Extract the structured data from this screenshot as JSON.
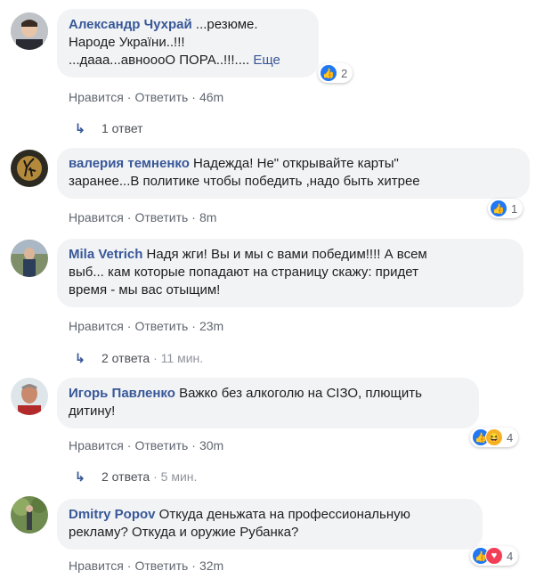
{
  "comments": [
    {
      "author": "Александр Чухрай",
      "text_lines": [
        " ...резюме.",
        "Народе України..!!!",
        "...дааа...авноооО ПОРА..!!!.... "
      ],
      "more": "Еще",
      "like": "Нравится",
      "reply": "Ответить",
      "time": "46m",
      "reactions": {
        "icons": [
          "like-icon"
        ],
        "count": "2"
      },
      "replies": {
        "label": "1 ответ",
        "ago": ""
      }
    },
    {
      "author": "валерия темненко",
      "text_lines": [
        " Надежда! Не\" открывайте карты\"",
        "заранее...В политике чтобы победить ,надо быть хитрее"
      ],
      "like": "Нравится",
      "reply": "Ответить",
      "time": "8m",
      "reactions": {
        "icons": [
          "like-icon"
        ],
        "count": "1"
      }
    },
    {
      "author": "Mila Vetrich",
      "text_lines": [
        " Надя жги! Вы и мы с вами победим!!!! А всем",
        "выб... кам которые попадают на страницу скажу: придет",
        "время - мы вас отыщим!"
      ],
      "like": "Нравится",
      "reply": "Ответить",
      "time": "23m",
      "replies": {
        "label": "2 ответа",
        "ago": " · 11 мин."
      }
    },
    {
      "author": "Игорь Павленко",
      "text_lines": [
        " Важко без алкоголю на СІЗО, плющить",
        "дитину!"
      ],
      "like": "Нравится",
      "reply": "Ответить",
      "time": "30m",
      "reactions": {
        "icons": [
          "like-icon",
          "haha-icon"
        ],
        "count": "4"
      },
      "replies": {
        "label": "2 ответа",
        "ago": " · 5 мин."
      }
    },
    {
      "author": "Dmitry Popov",
      "text_lines": [
        " Откуда деньжата на профессиональную",
        "рекламу? Откуда и оружие Рубанка?"
      ],
      "like": "Нравится",
      "reply": "Ответить",
      "time": "32m",
      "reactions": {
        "icons": [
          "like-icon",
          "love-icon"
        ],
        "count": "4"
      }
    }
  ],
  "colors": {
    "author": "#385898",
    "bubble": "#f2f3f5",
    "meta": "#606770",
    "like": "#2078f4",
    "love": "#f33e58",
    "haha": "#f7b125"
  }
}
